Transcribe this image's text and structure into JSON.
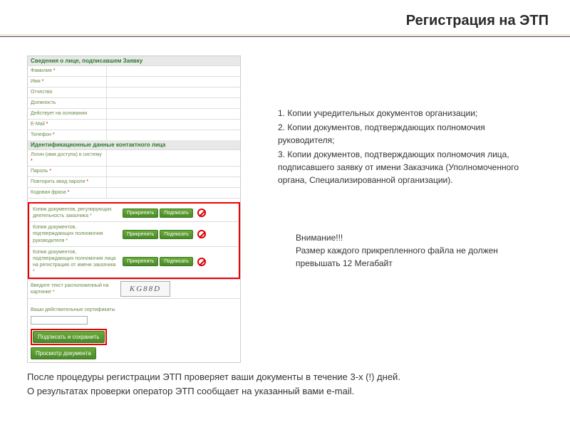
{
  "header": {
    "title": "Регистрация на ЭТП"
  },
  "form": {
    "section1_title": "Сведения о лице, подписавшем Заявку",
    "section2_title": "Идентификационные данные контактного лица",
    "fields1": [
      "Фамилия",
      "Имя",
      "Отчество",
      "Должность",
      "Действует на основании",
      "E-Mail",
      "Телефон"
    ],
    "fields2": [
      "Логин (имя доступа) в систему",
      "Пароль",
      "Повторить ввод пароля",
      "Кодовая фраза"
    ],
    "attachments": [
      "Копии документов, регулирующих деятельность заказчика",
      "Копии документов, подтверждающих полномочия руководителя",
      "Копии документов, подтверждающих полномочия лица на регистрацию от имени заказчика"
    ],
    "attach_btn": "Прикрепить",
    "sign_btn": "Подписать",
    "captcha_label": "Введите текст расположенный на картинке",
    "captcha_value": "KG88D",
    "cert_label": "Ваши действительные сертификаты",
    "submit_btn": "Подписать и сохранить",
    "view_btn": "Просмотр документа"
  },
  "right": {
    "item1": "1. Копии учредительных документов организации;",
    "item2": "2. Копии документов, подтверждающих полномочия руководителя;",
    "item3": "3. Копии документов, подтверждающих полномочия лица, подписавшего заявку от имени Заказчика (Уполномоченного органа, Специализированной организации)."
  },
  "warning": {
    "line1": "Внимание!!!",
    "line2": "Размер каждого прикрепленного файла не должен превышать 12 Мегабайт"
  },
  "bottom": {
    "line1": "После процедуры регистрации ЭТП проверяет ваши документы в течение 3-х (!) дней.",
    "line2": "О результатах проверки оператор ЭТП сообщает на указанный вами e-mail."
  }
}
